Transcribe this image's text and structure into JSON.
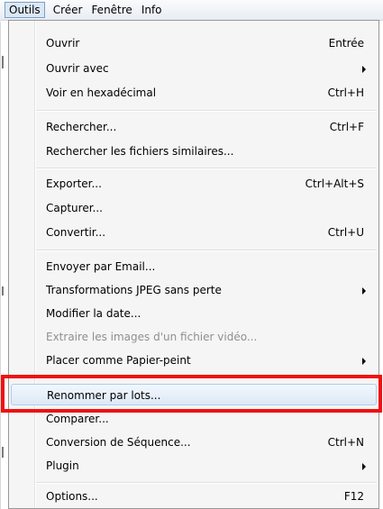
{
  "menubar": {
    "items": [
      {
        "label": "Outils",
        "active": true
      },
      {
        "label": "Créer",
        "active": false
      },
      {
        "label": "Fenêtre",
        "active": false
      },
      {
        "label": "Info",
        "active": false
      }
    ]
  },
  "menu": {
    "items": [
      {
        "label": "Ouvrir",
        "shortcut": "Entrée"
      },
      {
        "label": "Ouvrir avec",
        "submenu": true
      },
      {
        "label": "Voir en hexadécimal",
        "shortcut": "Ctrl+H"
      },
      {
        "label": "Rechercher...",
        "shortcut": "Ctrl+F"
      },
      {
        "label": "Rechercher les fichiers similaires..."
      },
      {
        "label": "Exporter...",
        "shortcut": "Ctrl+Alt+S"
      },
      {
        "label": "Capturer..."
      },
      {
        "label": "Convertir...",
        "shortcut": "Ctrl+U"
      },
      {
        "label": "Envoyer par Email..."
      },
      {
        "label": "Transformations JPEG sans perte",
        "submenu": true
      },
      {
        "label": "Modifier la date..."
      },
      {
        "label": "Extraire les images d'un fichier vidéo...",
        "disabled": true
      },
      {
        "label": "Placer comme Papier-peint",
        "submenu": true
      },
      {
        "label": "Renommer par lots...",
        "highlighted": true
      },
      {
        "label": "Comparer..."
      },
      {
        "label": "Conversion de Séquence...",
        "shortcut": "Ctrl+N"
      },
      {
        "label": "Plugin",
        "submenu": true
      },
      {
        "label": "Options...",
        "shortcut": "F12"
      }
    ]
  },
  "annotation": {
    "color": "#ee1111"
  }
}
